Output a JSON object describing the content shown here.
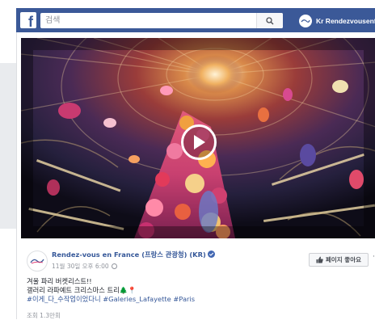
{
  "topbar": {
    "logo": "f",
    "search_placeholder": "검색",
    "profile_name": "Kr Rendezvousenfra"
  },
  "video": {
    "play_icon": "play-icon"
  },
  "post": {
    "page_name": "Rendez-vous en France (프랑스 관광청) (KR)",
    "timestamp": "11월 30일 오후 6:00",
    "like_page_label": "페이지 좋아요",
    "more_label": "···",
    "text_line1": "겨울 파리 버켓리스트!!",
    "text_line2": "갤러리 라파예트 크리스마스 트리",
    "text_line2_emoji": "🌲📍",
    "hashtags": "#이게_다_수작업이었다니 #Galeries_Lafayette #Paris",
    "views": "조회 1.3만회"
  },
  "colors": {
    "brand": "#3b5998",
    "link": "#365899",
    "meta": "#90949c"
  }
}
